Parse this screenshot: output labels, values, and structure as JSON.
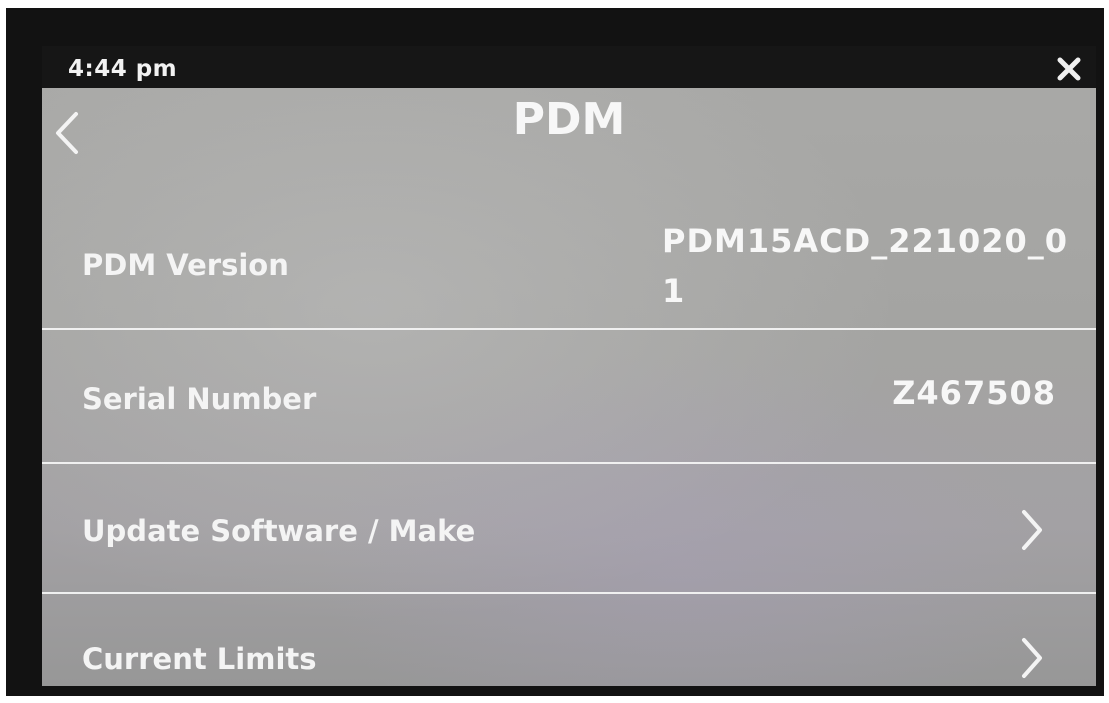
{
  "status_bar": {
    "time": "4:44 pm",
    "close_icon": "close-icon"
  },
  "header": {
    "title": "PDM",
    "back_icon": "chevron-left-icon"
  },
  "rows": [
    {
      "label": "PDM Version",
      "value": "PDM15ACD_221020_01"
    },
    {
      "label": "Serial Number",
      "value": "Z467508"
    },
    {
      "label": "Update Software / Make",
      "icon": "chevron-right-icon"
    },
    {
      "label": "Current Limits",
      "icon": "chevron-right-icon"
    }
  ],
  "colors": {
    "screen_background": "#a5a5a3",
    "status_bar": "#161616",
    "text": "#f4f4f4",
    "divider": "#f0f0f0"
  }
}
